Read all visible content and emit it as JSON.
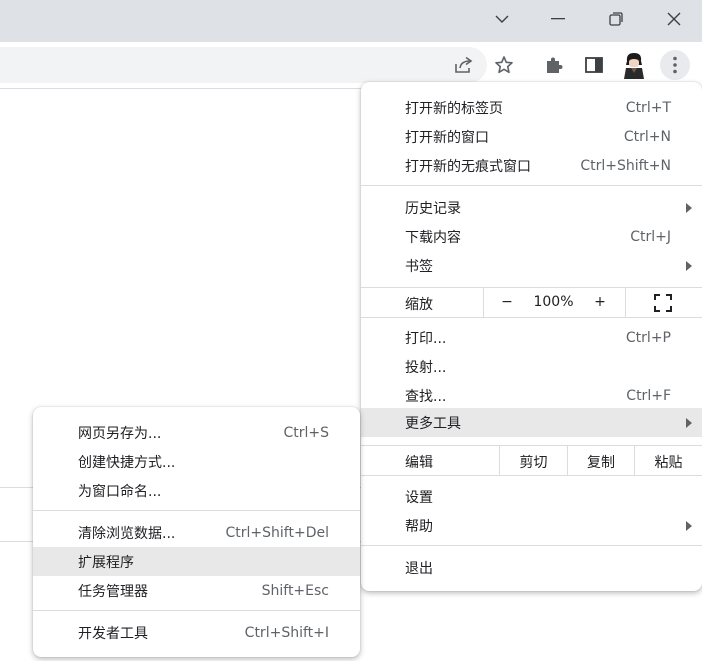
{
  "window": {
    "dropdown_icon": "chevron-down-icon",
    "minimize_icon": "minimize-icon",
    "restore_icon": "restore-icon",
    "close_icon": "close-icon"
  },
  "toolbar": {
    "share_icon": "share-icon",
    "bookmark_icon": "star-icon",
    "extensions_icon": "puzzle-icon",
    "sidepanel_icon": "side-panel-icon",
    "profile_icon": "avatar",
    "menu_icon": "kebab-menu-icon"
  },
  "main_menu": {
    "group1": [
      {
        "label": "打开新的标签页",
        "shortcut": "Ctrl+T"
      },
      {
        "label": "打开新的窗口",
        "shortcut": "Ctrl+N"
      },
      {
        "label": "打开新的无痕式窗口",
        "shortcut": "Ctrl+Shift+N"
      }
    ],
    "group2": [
      {
        "label": "历史记录",
        "shortcut": ""
      },
      {
        "label": "下载内容",
        "shortcut": "Ctrl+J"
      },
      {
        "label": "书签",
        "shortcut": ""
      }
    ],
    "zoom": {
      "label": "缩放",
      "minus": "−",
      "value": "100%",
      "plus": "+"
    },
    "group3": [
      {
        "label": "打印...",
        "shortcut": "Ctrl+P"
      },
      {
        "label": "投射...",
        "shortcut": ""
      },
      {
        "label": "查找...",
        "shortcut": "Ctrl+F"
      },
      {
        "label": "更多工具",
        "shortcut": ""
      }
    ],
    "edit": {
      "label": "编辑",
      "cut": "剪切",
      "copy": "复制",
      "paste": "粘贴"
    },
    "group4": [
      {
        "label": "设置",
        "shortcut": ""
      },
      {
        "label": "帮助",
        "shortcut": ""
      }
    ],
    "exit": {
      "label": "退出"
    }
  },
  "more_tools_menu": {
    "group1": [
      {
        "label": "网页另存为...",
        "shortcut": "Ctrl+S"
      },
      {
        "label": "创建快捷方式...",
        "shortcut": ""
      },
      {
        "label": "为窗口命名...",
        "shortcut": ""
      }
    ],
    "group2": [
      {
        "label": "清除浏览数据...",
        "shortcut": "Ctrl+Shift+Del"
      },
      {
        "label": "扩展程序",
        "shortcut": ""
      },
      {
        "label": "任务管理器",
        "shortcut": "Shift+Esc"
      }
    ],
    "group3": [
      {
        "label": "开发者工具",
        "shortcut": "Ctrl+Shift+I"
      }
    ]
  }
}
